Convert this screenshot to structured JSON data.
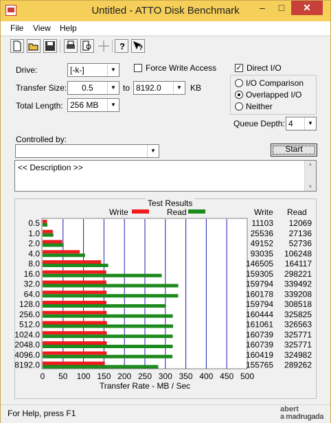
{
  "window": {
    "title": "Untitled - ATTO Disk Benchmark",
    "min_glyph": "–",
    "max_glyph": "□",
    "close_glyph": "✕"
  },
  "menu": [
    "File",
    "View",
    "Help"
  ],
  "toolbar": {
    "icons": [
      "new-file-icon",
      "open-folder-icon",
      "save-icon",
      "print-icon",
      "print-preview-icon",
      "move-icon",
      "help-icon",
      "context-help-icon"
    ]
  },
  "controls": {
    "drive_label": "Drive:",
    "drive_value": "[-k-]",
    "force_write_label": "Force Write Access",
    "force_write_checked": false,
    "direct_io_label": "Direct I/O",
    "direct_io_checked": true,
    "transfer_size_label": "Transfer Size:",
    "transfer_from": "0.5",
    "to_label": "to",
    "transfer_to": "8192.0",
    "kb_label": "KB",
    "total_length_label": "Total Length:",
    "total_length_value": "256 MB",
    "io_options": [
      {
        "label": "I/O Comparison",
        "selected": false
      },
      {
        "label": "Overlapped I/O",
        "selected": true
      },
      {
        "label": "Neither",
        "selected": false
      }
    ],
    "queue_depth_label": "Queue Depth:",
    "queue_depth_value": "4",
    "controlled_by_label": "Controlled by:",
    "controlled_by_value": "",
    "start_label": "Start",
    "description": "<< Description >>"
  },
  "results": {
    "title": "Test Results",
    "legend_write": "Write",
    "legend_read": "Read",
    "col_write": "Write",
    "col_read": "Read",
    "write_color": "#ee1c1c",
    "read_color": "#1c8a1c"
  },
  "chart_data": {
    "type": "bar",
    "orientation": "horizontal",
    "xlabel": "Transfer Rate - MB / Sec",
    "xlim": [
      0,
      500
    ],
    "xticks": [
      "0",
      "50",
      "100",
      "150",
      "200",
      "250",
      "300",
      "350",
      "400",
      "450",
      "500"
    ],
    "categories": [
      "0.5",
      "1.0",
      "2.0",
      "4.0",
      "8.0",
      "16.0",
      "32.0",
      "64.0",
      "128.0",
      "256.0",
      "512.0",
      "1024.0",
      "2048.0",
      "4096.0",
      "8192.0"
    ],
    "series": [
      {
        "name": "Write",
        "values": [
          10.8,
          25.0,
          48.0,
          90.9,
          143.1,
          155.6,
          156.0,
          156.4,
          156.0,
          156.7,
          157.3,
          157.0,
          157.0,
          156.7,
          152.1
        ]
      },
      {
        "name": "Read",
        "values": [
          11.8,
          26.5,
          51.5,
          103.8,
          160.3,
          291.2,
          331.5,
          331.3,
          301.3,
          318.2,
          318.9,
          318.1,
          318.1,
          317.4,
          282.5
        ]
      }
    ],
    "write_values_text": [
      "11103",
      "25536",
      "49152",
      "93035",
      "146505",
      "159305",
      "159794",
      "160178",
      "159794",
      "160444",
      "161061",
      "160739",
      "160739",
      "160419",
      "155765"
    ],
    "read_values_text": [
      "12069",
      "27136",
      "52736",
      "106248",
      "164117",
      "298221",
      "339492",
      "339208",
      "308518",
      "325825",
      "326563",
      "325771",
      "325771",
      "324982",
      "289262"
    ],
    "grid": true,
    "legend": "top"
  },
  "status": {
    "text": "For Help, press F1",
    "logo_line1": "abert",
    "logo_line2": "a madrugada"
  }
}
